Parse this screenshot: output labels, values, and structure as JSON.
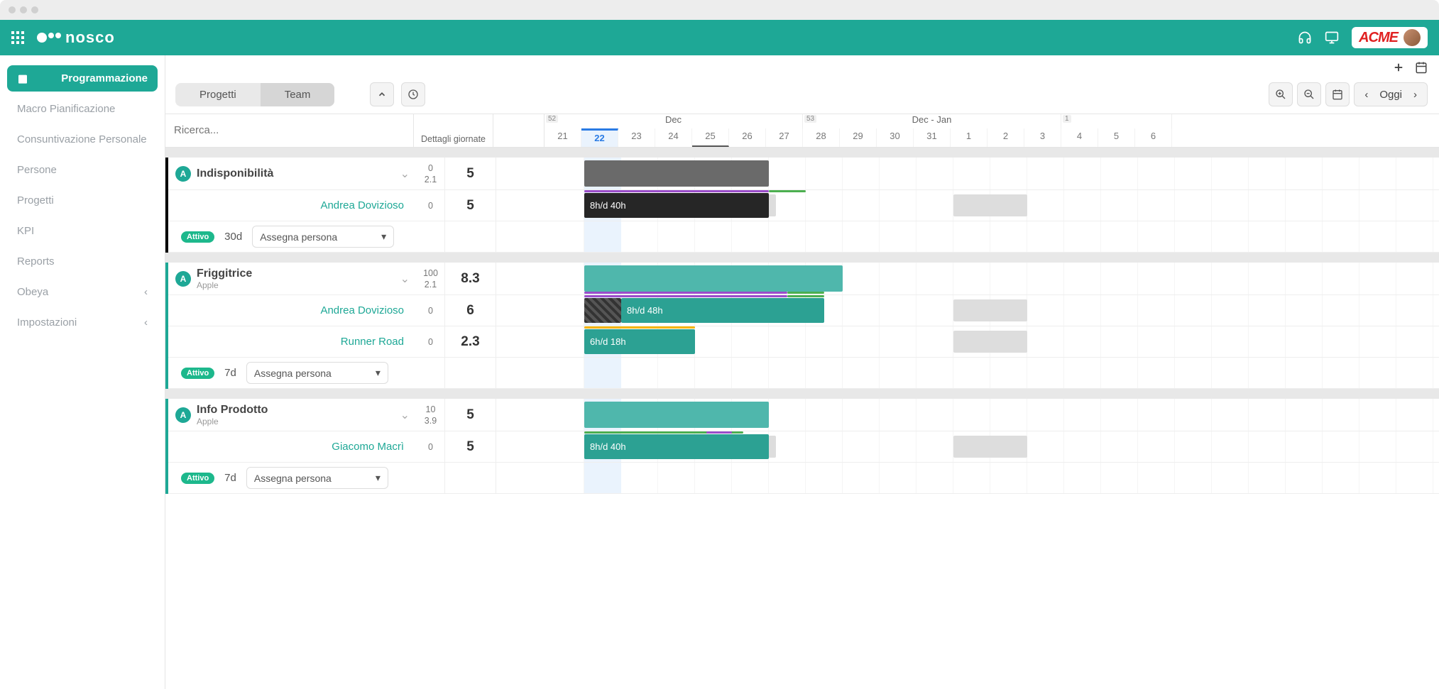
{
  "brand": {
    "name": "nosco",
    "client": "ACME"
  },
  "sidebar": {
    "items": [
      {
        "label": "Programmazione",
        "active": true
      },
      {
        "label": "Macro Pianificazione"
      },
      {
        "label": "Consuntivazione Personale"
      },
      {
        "label": "Persone"
      },
      {
        "label": "Progetti"
      },
      {
        "label": "KPI"
      },
      {
        "label": "Reports"
      },
      {
        "label": "Obeya",
        "chevron": true
      },
      {
        "label": "Impostazioni",
        "chevron": true
      }
    ]
  },
  "toolbar": {
    "tabs": {
      "a": "Progetti",
      "b": "Team"
    },
    "today": "Oggi",
    "search_placeholder": "Ricerca...",
    "detail_label": "Dettagli giornate"
  },
  "timeline": {
    "months": [
      {
        "label": "Dec",
        "week": "52",
        "span": 7
      },
      {
        "label": "Dec - Jan",
        "week": "53",
        "span": 7
      },
      {
        "label": "",
        "week": "1",
        "span": 3
      }
    ],
    "days": [
      "21",
      "22",
      "23",
      "24",
      "25",
      "26",
      "27",
      "28",
      "29",
      "30",
      "31",
      "1",
      "2",
      "3",
      "4",
      "5",
      "6"
    ],
    "today_index": 1,
    "holiday_index": 4
  },
  "projects": [
    {
      "badge": "A",
      "name": "Indisponibilità",
      "subtitle": "",
      "border": "black",
      "header_nums": [
        "0",
        "2.1"
      ],
      "header_big": "5",
      "rows": [
        {
          "person": "Andrea Dovizioso",
          "n1": "0",
          "big": "5",
          "bar_label": "8h/d 40h"
        }
      ],
      "status": "Attivo",
      "duration": "30d",
      "assign": "Assegna persona"
    },
    {
      "badge": "A",
      "name": "Friggitrice",
      "subtitle": "Apple",
      "border": "teal",
      "header_nums": [
        "100",
        "2.1"
      ],
      "header_big": "8.3",
      "rows": [
        {
          "person": "Andrea Dovizioso",
          "n1": "0",
          "big": "6",
          "bar_label": "8h/d 48h"
        },
        {
          "person": "Runner Road",
          "n1": "0",
          "big": "2.3",
          "bar_label": "6h/d 18h"
        }
      ],
      "status": "Attivo",
      "duration": "7d",
      "assign": "Assegna persona"
    },
    {
      "badge": "A",
      "name": "Info Prodotto",
      "subtitle": "Apple",
      "border": "teal",
      "header_nums": [
        "10",
        "3.9"
      ],
      "header_big": "5",
      "rows": [
        {
          "person": "Giacomo Macrì",
          "n1": "0",
          "big": "5",
          "bar_label": "8h/d 40h"
        }
      ],
      "status": "Attivo",
      "duration": "7d",
      "assign": "Assegna persona"
    }
  ]
}
